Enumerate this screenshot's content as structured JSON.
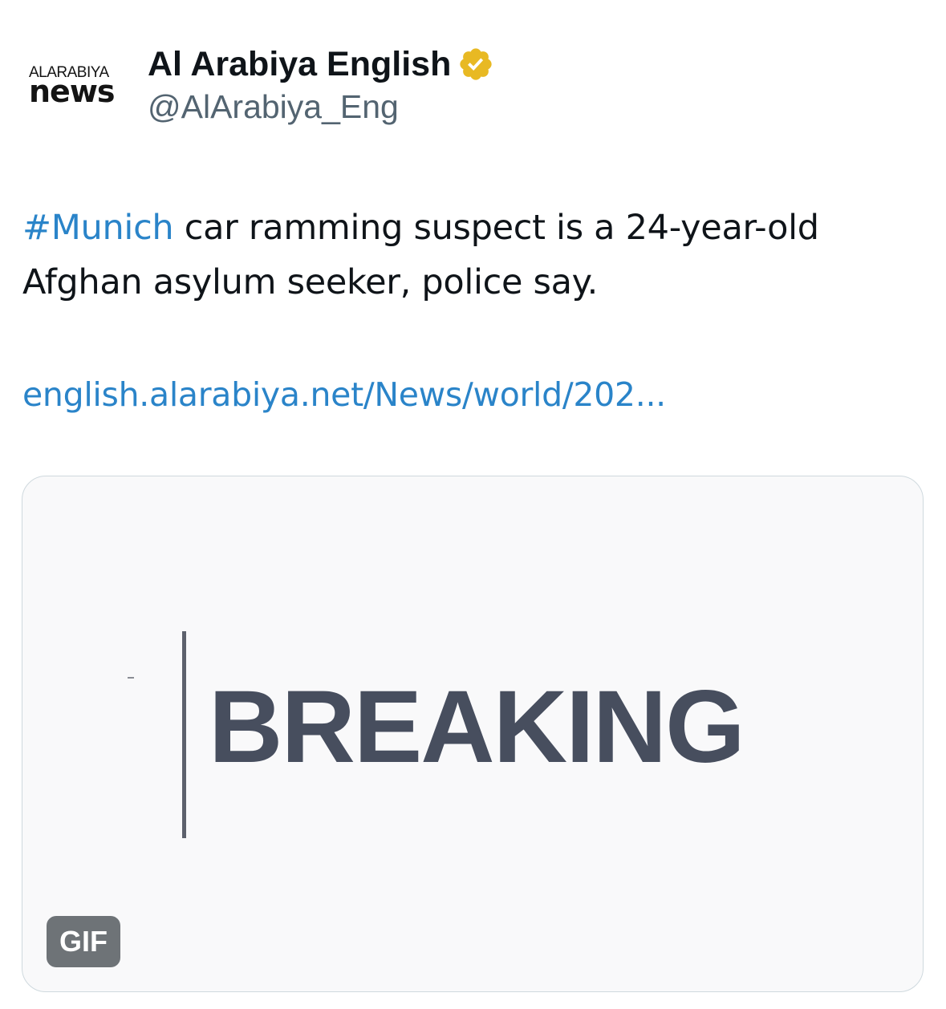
{
  "author": {
    "avatar_brand_top": "ALARABIYA",
    "avatar_brand_bottom": "news",
    "display_name": "Al Arabiya English",
    "handle": "@AlArabiya_Eng",
    "verified_badge_color": "#e8b923",
    "verified_icon": "verified-badge-icon"
  },
  "tweet": {
    "hashtag": "#Munich",
    "text_after_hashtag": " car ramming suspect is a 24-year-old Afghan asylum seeker, police say.",
    "link": "english.alarabiya.net/News/world/202..."
  },
  "media": {
    "headline": "BREAKING",
    "badge": "GIF"
  },
  "colors": {
    "link": "#2a84c9",
    "text": "#0f1419",
    "secondary": "#536471",
    "breaking_text": "#474e5e"
  }
}
